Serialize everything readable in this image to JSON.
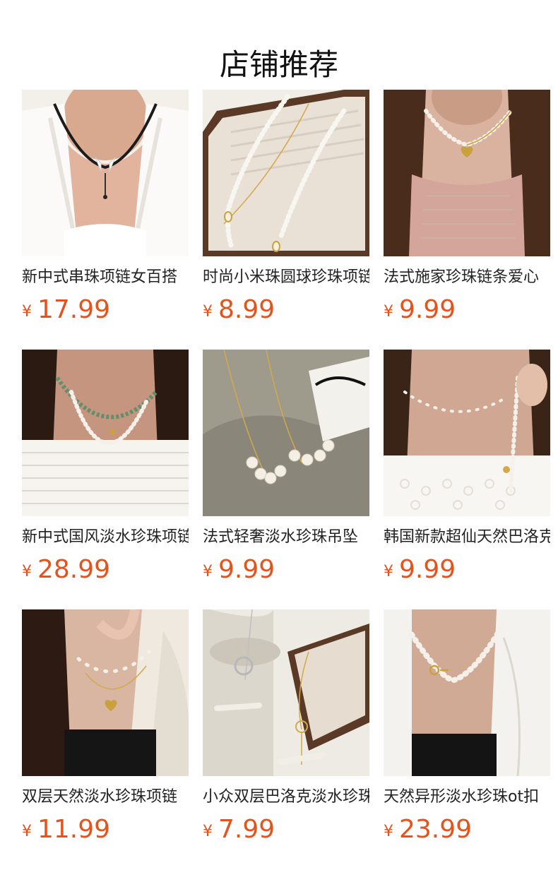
{
  "section_title": "店铺推荐",
  "colors": {
    "price": "#e4531c",
    "title": "#111111",
    "text": "#222222"
  },
  "products": [
    {
      "name": "新中式串珠项链女百搭",
      "currency": "¥",
      "price": "17.99",
      "image_icon": "necklace-photo-icon"
    },
    {
      "name": "时尚小米珠圆球珍珠项链",
      "currency": "¥",
      "price": "8.99",
      "image_icon": "necklace-photo-icon"
    },
    {
      "name": "法式施家珍珠链条爱心",
      "currency": "¥",
      "price": "9.99",
      "image_icon": "necklace-photo-icon"
    },
    {
      "name": "新中式国风淡水珍珠项链",
      "currency": "¥",
      "price": "28.99",
      "image_icon": "necklace-photo-icon"
    },
    {
      "name": "法式轻奢淡水珍珠吊坠",
      "currency": "¥",
      "price": "9.99",
      "image_icon": "necklace-photo-icon"
    },
    {
      "name": "韩国新款超仙天然巴洛克",
      "currency": "¥",
      "price": "9.99",
      "image_icon": "necklace-photo-icon"
    },
    {
      "name": "双层天然淡水珍珠项链",
      "currency": "¥",
      "price": "11.99",
      "image_icon": "necklace-photo-icon"
    },
    {
      "name": "小众双层巴洛克淡水珍珠",
      "currency": "¥",
      "price": "7.99",
      "image_icon": "necklace-photo-icon"
    },
    {
      "name": "天然异形淡水珍珠ot扣",
      "currency": "¥",
      "price": "23.99",
      "image_icon": "necklace-photo-icon"
    }
  ]
}
